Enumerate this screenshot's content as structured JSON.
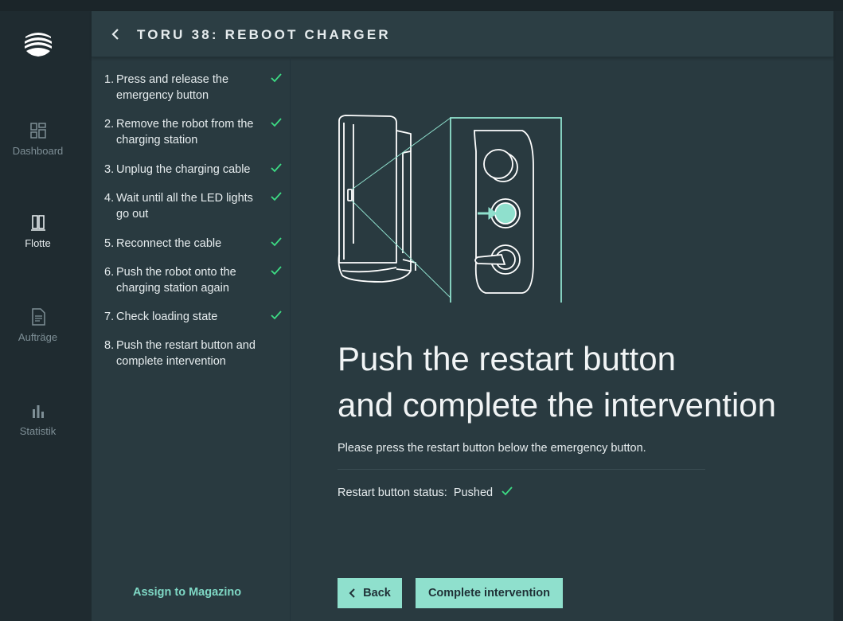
{
  "nav": {
    "items": [
      {
        "label": "Dashboard",
        "icon": "dashboard-icon",
        "active": false
      },
      {
        "label": "Flotte",
        "icon": "fleet-icon",
        "active": true
      },
      {
        "label": "Aufträge",
        "icon": "document-icon",
        "active": false
      },
      {
        "label": "Statistik",
        "icon": "bar-chart-icon",
        "active": false
      }
    ]
  },
  "header": {
    "title": "TORU 38: REBOOT CHARGER"
  },
  "steps": [
    {
      "num": "1.",
      "text": "Press and release the emergency button",
      "done": true
    },
    {
      "num": "2.",
      "text": "Remove the robot from the charging station",
      "done": true
    },
    {
      "num": "3.",
      "text": "Unplug the charging cable",
      "done": true
    },
    {
      "num": "4.",
      "text": "Wait until all the LED lights go out",
      "done": true
    },
    {
      "num": "5.",
      "text": "Reconnect the cable",
      "done": true
    },
    {
      "num": "6.",
      "text": "Push the robot onto the charging station again",
      "done": true
    },
    {
      "num": "7.",
      "text": "Check loading state",
      "done": true
    },
    {
      "num": "8.",
      "text": "Push the restart button and complete intervention",
      "done": false
    }
  ],
  "assign_link": "Assign to Magazino",
  "content": {
    "heading_line1": "Push the restart button",
    "heading_line2": "and complete the intervention",
    "description": "Please press the restart button below the emergency button.",
    "status_label": "Restart button status:",
    "status_value": "Pushed"
  },
  "buttons": {
    "back": "Back",
    "complete": "Complete intervention"
  },
  "colors": {
    "accent": "#8fe0cd",
    "check": "#3ddc84",
    "panel": "#293a40",
    "nav": "#1f2b30"
  }
}
